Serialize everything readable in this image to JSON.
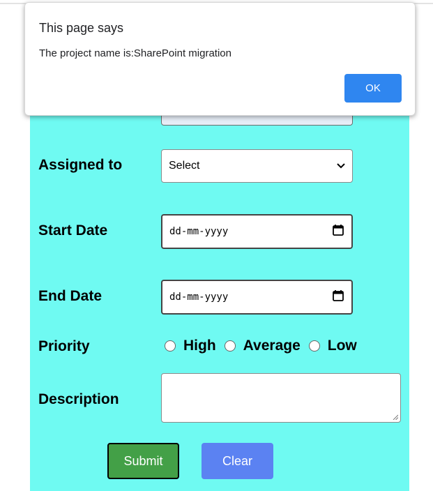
{
  "form": {
    "assigned_to_label": "Assigned to",
    "assigned_to_value": "Select",
    "start_date_label": "Start Date",
    "start_date_placeholder": "dd-mm-yyyy",
    "end_date_label": "End Date",
    "end_date_placeholder": "dd-mm-yyyy",
    "priority_label": "Priority",
    "priority_options": [
      "High",
      "Average",
      "Low"
    ],
    "description_label": "Description",
    "submit_label": "Submit",
    "clear_label": "Clear"
  },
  "dialog": {
    "title": "This page says",
    "message": "The project name is:SharePoint migration",
    "ok_label": "OK"
  },
  "colors": {
    "panel_background": "#6ffaf2",
    "submit_button": "#43a047",
    "clear_button": "#5b82f2",
    "ok_button": "#2f86f0"
  }
}
